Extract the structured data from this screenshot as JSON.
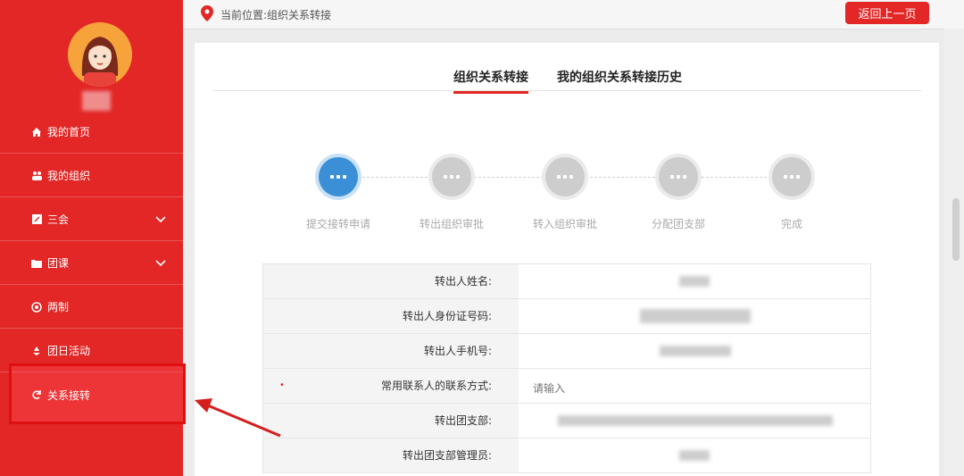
{
  "sidebar": {
    "items": [
      {
        "label": "我的首页",
        "icon": "home-icon"
      },
      {
        "label": "我的组织",
        "icon": "group-icon"
      },
      {
        "label": "三会",
        "icon": "edit-icon"
      },
      {
        "label": "团课",
        "icon": "folder-icon"
      },
      {
        "label": "两制",
        "icon": "target-icon"
      },
      {
        "label": "团日活动",
        "icon": "recycle-icon"
      },
      {
        "label": "关系接转",
        "icon": "refresh-icon"
      }
    ]
  },
  "header": {
    "breadcrumb": "当前位置:组织关系转接",
    "back_label": "返回上一页"
  },
  "tabs": [
    {
      "label": "组织关系转接"
    },
    {
      "label": "我的组织关系转接历史"
    }
  ],
  "steps": [
    {
      "label": "提交接转申请",
      "status": "done"
    },
    {
      "label": "转出组织审批",
      "status": "todo"
    },
    {
      "label": "转入组织审批",
      "status": "todo"
    },
    {
      "label": "分配团支部",
      "status": "todo"
    },
    {
      "label": "完成",
      "status": "todo"
    }
  ],
  "form": {
    "rows": [
      {
        "label": "转出人姓名:"
      },
      {
        "label": "转出人身份证号码:"
      },
      {
        "label": "转出人手机号:"
      },
      {
        "label": "常用联系人的联系方式:",
        "required": true,
        "placeholder": "请输入"
      },
      {
        "label": "转出团支部:"
      },
      {
        "label": "转出团支部管理员:"
      }
    ]
  },
  "colors": {
    "primary": "#e32626",
    "step_active": "#3a8fd6",
    "step_inactive": "#cdcdcd"
  }
}
